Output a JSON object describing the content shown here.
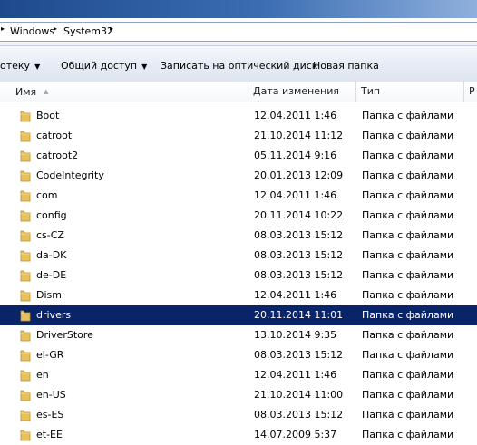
{
  "address": {
    "crumbs": [
      "Windows",
      "System32"
    ]
  },
  "toolbar": {
    "items": [
      {
        "label": "отеку",
        "has_dropdown": true
      },
      {
        "label": "Общий доступ",
        "has_dropdown": true
      },
      {
        "label": "Записать на оптический диск",
        "has_dropdown": false
      },
      {
        "label": "Новая папка",
        "has_dropdown": false
      }
    ]
  },
  "columns": {
    "name": "Имя",
    "date": "Дата изменения",
    "type": "Тип",
    "extra": "Р"
  },
  "files": [
    {
      "name": "Boot",
      "date": "12.04.2011 1:46",
      "type": "Папка с файлами"
    },
    {
      "name": "catroot",
      "date": "21.10.2014 11:12",
      "type": "Папка с файлами"
    },
    {
      "name": "catroot2",
      "date": "05.11.2014 9:16",
      "type": "Папка с файлами"
    },
    {
      "name": "CodeIntegrity",
      "date": "20.01.2013 12:09",
      "type": "Папка с файлами"
    },
    {
      "name": "com",
      "date": "12.04.2011 1:46",
      "type": "Папка с файлами"
    },
    {
      "name": "config",
      "date": "20.11.2014 10:22",
      "type": "Папка с файлами"
    },
    {
      "name": "cs-CZ",
      "date": "08.03.2013 15:12",
      "type": "Папка с файлами"
    },
    {
      "name": "da-DK",
      "date": "08.03.2013 15:12",
      "type": "Папка с файлами"
    },
    {
      "name": "de-DE",
      "date": "08.03.2013 15:12",
      "type": "Папка с файлами"
    },
    {
      "name": "Dism",
      "date": "12.04.2011 1:46",
      "type": "Папка с файлами"
    },
    {
      "name": "drivers",
      "date": "20.11.2014 11:01",
      "type": "Папка с файлами",
      "selected": true
    },
    {
      "name": "DriverStore",
      "date": "13.10.2014 9:35",
      "type": "Папка с файлами"
    },
    {
      "name": "el-GR",
      "date": "08.03.2013 15:12",
      "type": "Папка с файлами"
    },
    {
      "name": "en",
      "date": "12.04.2011 1:46",
      "type": "Папка с файлами"
    },
    {
      "name": "en-US",
      "date": "21.10.2014 11:00",
      "type": "Папка с файлами"
    },
    {
      "name": "es-ES",
      "date": "08.03.2013 15:12",
      "type": "Папка с файлами"
    },
    {
      "name": "et-EE",
      "date": "14.07.2009 5:37",
      "type": "Папка с файлами"
    }
  ],
  "colors": {
    "selection": "#0a246a",
    "folder": "#e8c15a"
  },
  "icons": {
    "folder": "folder-icon"
  }
}
